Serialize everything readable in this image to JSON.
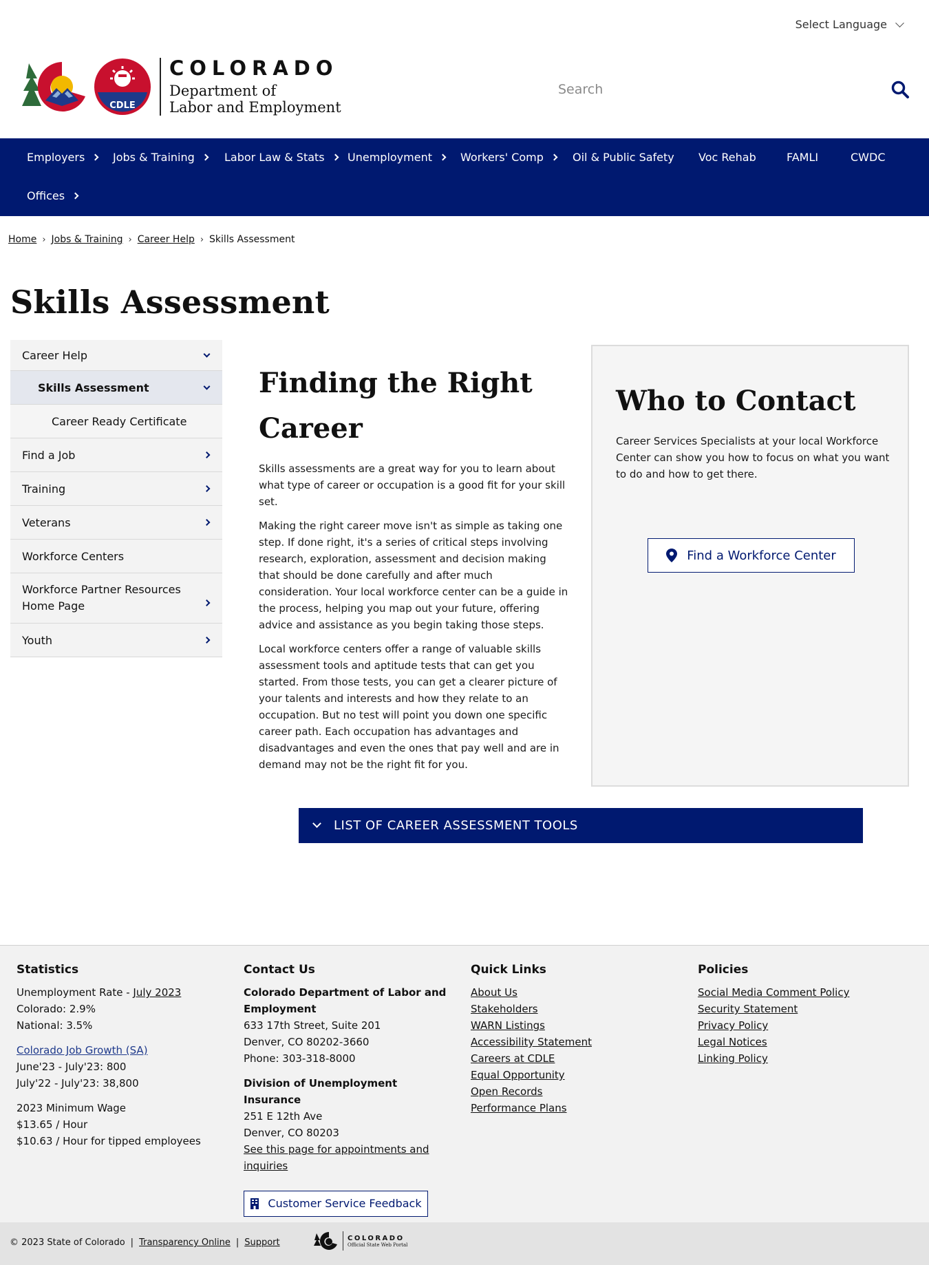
{
  "header": {
    "language_select": "Select Language",
    "logo_state": "COLORADO",
    "logo_dept_line1": "Department of",
    "logo_dept_line2": "Labor and Employment",
    "logo_badge": "CDLE",
    "search_placeholder": "Search"
  },
  "nav": {
    "items": [
      {
        "label": "Employers",
        "has_submenu": true
      },
      {
        "label": "Jobs & Training",
        "has_submenu": true
      },
      {
        "label": "Labor Law & Stats",
        "has_submenu": true
      },
      {
        "label": "Unemployment",
        "has_submenu": true
      },
      {
        "label": "Workers' Comp",
        "has_submenu": true
      },
      {
        "label": "Oil & Public Safety",
        "has_submenu": false
      },
      {
        "label": "Voc Rehab",
        "has_submenu": false
      },
      {
        "label": "FAMLI",
        "has_submenu": false
      },
      {
        "label": "CWDC",
        "has_submenu": false
      },
      {
        "label": "Offices",
        "has_submenu": true
      }
    ]
  },
  "breadcrumb": [
    "Home",
    "Jobs & Training",
    "Career Help",
    "Skills Assessment"
  ],
  "page_title": "Skills Assessment",
  "sidenav": [
    {
      "label": "Career Help",
      "state": "expanded"
    },
    {
      "label": "Skills Assessment",
      "state": "active-expanded"
    },
    {
      "label": "Career Ready Certificate",
      "state": "sub"
    },
    {
      "label": "Find a Job",
      "state": "collapsed"
    },
    {
      "label": "Training",
      "state": "collapsed"
    },
    {
      "label": "Veterans",
      "state": "collapsed"
    },
    {
      "label": "Workforce Centers",
      "state": "leaf"
    },
    {
      "label": "Workforce Partner Resources Home Page",
      "state": "collapsed"
    },
    {
      "label": "Youth",
      "state": "collapsed"
    }
  ],
  "article": {
    "heading": "Finding the Right Career",
    "paragraphs": [
      "Skills assessments are a great way for you to learn about what type of career or occupation is a good fit for your skill set.",
      "Making the right career move isn't as simple as taking one step. If done right, it's a series of critical steps involving research, exploration, assessment and decision making that should be done carefully and after much consideration. Your local workforce center can be a guide in the process, helping you map out your future, offering advice and assistance as you begin taking those steps.",
      "Local workforce centers offer a range of valuable skills assessment tools and aptitude tests that can get you started. From those tests, you can get a clearer picture of your talents and interests and how they relate to an occupation. But no test will point you down one specific career path. Each occupation has advantages and disadvantages and even the ones that pay well and are in demand may not be the right fit for you."
    ]
  },
  "contact": {
    "heading": "Who to Contact",
    "text": "Career Services Specialists at your local Workforce Center can show you how to focus on what you want to do and how to get there.",
    "button": "Find a Workforce Center"
  },
  "accordion": {
    "label": "LIST OF CAREER ASSESSMENT TOOLS"
  },
  "footer": {
    "statistics": {
      "heading": "Statistics",
      "unemployment_label": "Unemployment Rate - ",
      "unemployment_link": "July 2023",
      "colorado": "Colorado: 2.9%",
      "national": "National: 3.5%",
      "job_growth_link": "Colorado Job Growth (SA)",
      "growth_1": "June'23 - July'23: 800",
      "growth_2": "July'22 - July'23: 38,800",
      "min_wage_title": "2023 Minimum Wage",
      "min_wage_1": "$13.65 / Hour",
      "min_wage_2": "$10.63 / Hour for tipped employees"
    },
    "contact": {
      "heading": "Contact Us",
      "org1_name": "Colorado Department of Labor and Employment",
      "org1_addr1": "633 17th Street, Suite 201",
      "org1_addr2": "Denver, CO  80202-3660",
      "org1_phone": "Phone: 303-318-8000",
      "org2_name": "Division of Unemployment Insurance",
      "org2_addr1": "251 E 12th Ave",
      "org2_addr2": "Denver, CO  80203",
      "org2_link": "See this page for appointments and inquiries",
      "feedback_button": "Customer Service Feedback"
    },
    "quick_links": {
      "heading": "Quick Links",
      "links": [
        "About Us",
        "Stakeholders",
        "WARN Listings",
        "Accessibility Statement",
        "Careers at CDLE",
        "Equal Opportunity",
        "Open Records",
        "Performance Plans"
      ]
    },
    "policies": {
      "heading": "Policies",
      "links": [
        "Social Media Comment Policy",
        "Security Statement",
        "Privacy Policy",
        "Legal Notices",
        "Linking Policy"
      ]
    }
  },
  "bottom_bar": {
    "copyright": "© 2023 State of Colorado",
    "sep": "|",
    "transparency": "Transparency Online",
    "support": "Support",
    "portal_name": "COLORADO",
    "portal_sub": "Official State Web Portal"
  },
  "colors": {
    "brand_navy": "#001970",
    "co_red": "#c8102e",
    "co_blue": "#1d3a8a",
    "co_gold": "#f2b800",
    "co_green": "#2e6b3a"
  },
  "icons": [
    "chevron-down-icon",
    "search-icon",
    "chevron-right-icon",
    "map-pin-icon",
    "building-icon",
    "colorado-logo",
    "cdle-logo"
  ]
}
